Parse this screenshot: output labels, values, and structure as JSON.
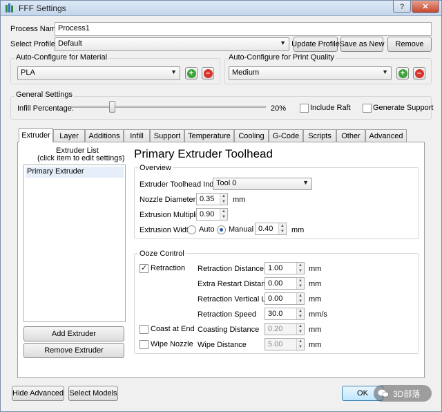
{
  "window": {
    "title": "FFF Settings",
    "help_glyph": "?",
    "close_glyph": "✕"
  },
  "process": {
    "name_label": "Process Name:",
    "name_value": "Process1"
  },
  "profile": {
    "label": "Select Profile:",
    "value": "Default",
    "update_label": "Update Profile",
    "save_as_new_label": "Save as New",
    "remove_label": "Remove"
  },
  "material": {
    "group_title": "Auto-Configure for Material",
    "value": "PLA"
  },
  "quality": {
    "group_title": "Auto-Configure for Print Quality",
    "value": "Medium"
  },
  "general": {
    "group_title": "General Settings",
    "infill_label": "Infill Percentage:",
    "infill_percent": 20,
    "infill_value_text": "20%",
    "include_raft_label": "Include Raft",
    "include_raft_checked": false,
    "support_label": "Generate Support",
    "support_checked": false
  },
  "tabs": [
    "Extruder",
    "Layer",
    "Additions",
    "Infill",
    "Support",
    "Temperature",
    "Cooling",
    "G-Code",
    "Scripts",
    "Other",
    "Advanced"
  ],
  "extruder_list": {
    "title_line1": "Extruder List",
    "title_line2": "(click item to edit settings)",
    "items": [
      "Primary Extruder"
    ],
    "add_label": "Add Extruder",
    "remove_label": "Remove Extruder"
  },
  "toolhead": {
    "heading": "Primary Extruder Toolhead",
    "overview_title": "Overview",
    "index_label": "Extruder Toolhead Index",
    "index_value": "Tool 0",
    "nozzle_label": "Nozzle Diameter",
    "nozzle_value": "0.35",
    "nozzle_unit": "mm",
    "multiplier_label": "Extrusion Multiplier",
    "multiplier_value": "0.90",
    "width_label": "Extrusion Width",
    "width_auto": "Auto",
    "width_manual": "Manual",
    "width_value": "0.40",
    "width_unit": "mm"
  },
  "ooze": {
    "title": "Ooze Control",
    "retraction_label": "Retraction",
    "retraction_checked": true,
    "check_glyph": "✓",
    "coast_label": "Coast at End",
    "coast_checked": false,
    "wipe_label": "Wipe Nozzle",
    "wipe_checked": false,
    "rows": {
      "distance": {
        "label": "Retraction Distance",
        "value": "1.00",
        "unit": "mm"
      },
      "restart": {
        "label": "Extra Restart Distance",
        "value": "0.00",
        "unit": "mm"
      },
      "lift": {
        "label": "Retraction Vertical Lift",
        "value": "0.00",
        "unit": "mm"
      },
      "speed": {
        "label": "Retraction Speed",
        "value": "30.0",
        "unit": "mm/s"
      },
      "coasting": {
        "label": "Coasting Distance",
        "value": "0.20",
        "unit": "mm"
      },
      "wipe": {
        "label": "Wipe Distance",
        "value": "5.00",
        "unit": "mm"
      }
    }
  },
  "footer": {
    "hide_advanced_label": "Hide Advanced",
    "select_models_label": "Select Models",
    "ok_label": "OK"
  },
  "watermark": {
    "text": "3D部落"
  },
  "icons": {
    "add": "plus-circle-icon",
    "remove": "minus-circle-icon",
    "app": "app-bars-icon"
  },
  "colors": {
    "add_green": "#3fa53a",
    "remove_red": "#d9342b",
    "title_gradient_top": "#dce8f5",
    "panel_border": "#a0a0a0"
  }
}
